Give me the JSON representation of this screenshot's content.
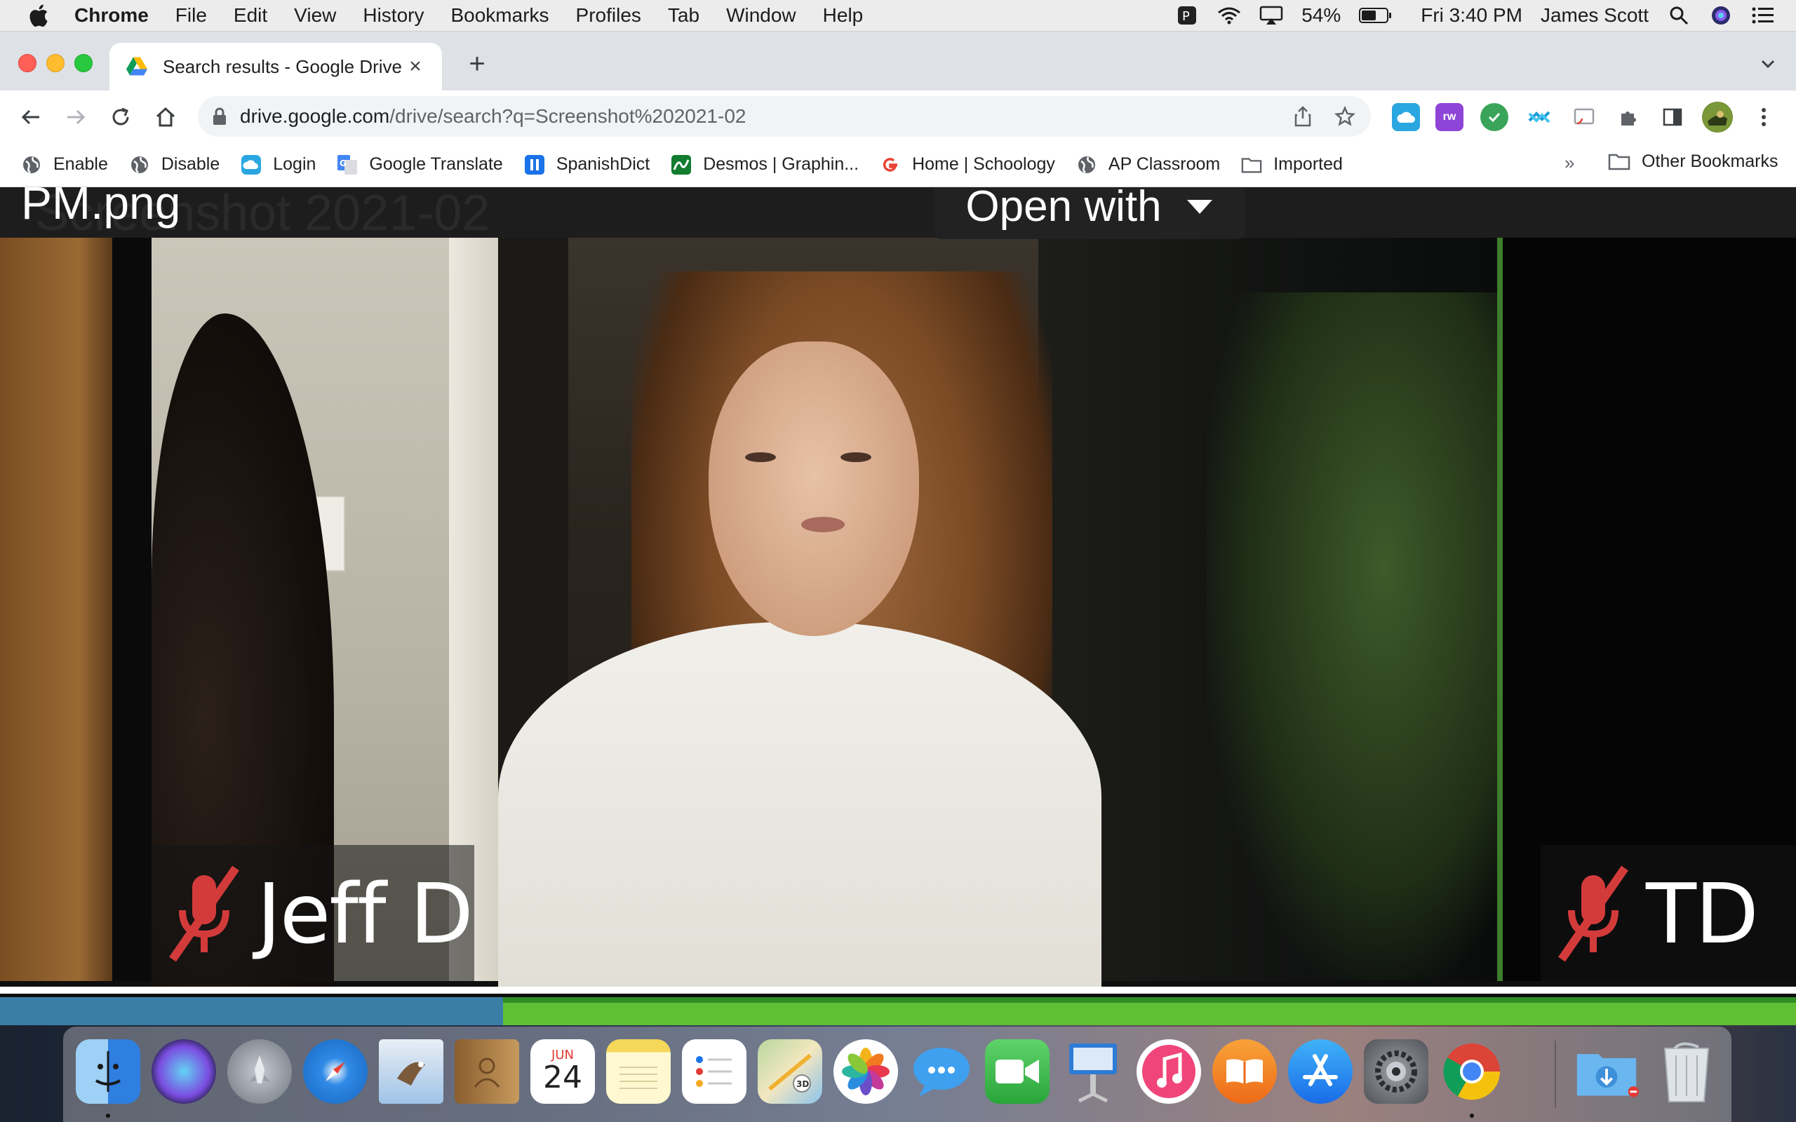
{
  "menubar": {
    "app": "Chrome",
    "items": [
      "File",
      "Edit",
      "View",
      "History",
      "Bookmarks",
      "Profiles",
      "Tab",
      "Window",
      "Help"
    ],
    "battery": "54%",
    "clock": "Fri 3:40 PM",
    "user": "James Scott"
  },
  "tab": {
    "title": "Search results - Google Drive",
    "close": "×",
    "new_tab": "+"
  },
  "omnibox": {
    "host": "drive.google.com",
    "path": "/drive/search?q=Screenshot%202021-02"
  },
  "extensions": [
    {
      "name": "cloud-extension-icon",
      "color": "#2aa7e0",
      "label": ""
    },
    {
      "name": "rw-extension-icon",
      "color": "#8e44d6",
      "label": "rw"
    },
    {
      "name": "grammar-extension-icon",
      "color": "#3aa55a",
      "label": ""
    },
    {
      "name": "sync-extension-icon",
      "color": "#1a9bd7",
      "label": ""
    },
    {
      "name": "cast-extension-icon",
      "color": "#9aa0a6",
      "label": ""
    }
  ],
  "bookmarks": [
    {
      "label": "Enable",
      "icon": "globe-icon"
    },
    {
      "label": "Disable",
      "icon": "globe-icon"
    },
    {
      "label": "Login",
      "icon": "cloud-icon"
    },
    {
      "label": "Google Translate",
      "icon": "translate-icon"
    },
    {
      "label": "SpanishDict",
      "icon": "spanishdict-icon"
    },
    {
      "label": "Desmos | Graphin...",
      "icon": "desmos-icon"
    },
    {
      "label": "Home | Schoology",
      "icon": "google-icon"
    },
    {
      "label": "AP Classroom",
      "icon": "globe-icon"
    },
    {
      "label": "Imported",
      "icon": "folder-icon"
    }
  ],
  "bookmarks_more": "»",
  "bookmarks_other": "Other Bookmarks",
  "viewer": {
    "filename_ghost": "Screenshot 2021-02",
    "filename": "PM.png",
    "open_with": "Open with",
    "participants": [
      "Jeff D",
      "TD"
    ],
    "progress": 0.28
  },
  "dock": [
    {
      "name": "finder-icon",
      "color": "#3d8fe8"
    },
    {
      "name": "siri-icon",
      "color": "#5b3fb0"
    },
    {
      "name": "launchpad-icon",
      "color": "#7b8088"
    },
    {
      "name": "safari-icon",
      "color": "#2f8ae6"
    },
    {
      "name": "mail-icon",
      "color": "#6aa6d8"
    },
    {
      "name": "contacts-icon",
      "color": "#b8864a"
    },
    {
      "name": "calendar-icon",
      "color": "#ffffff"
    },
    {
      "name": "notes-icon",
      "color": "#f7e27a"
    },
    {
      "name": "reminders-icon",
      "color": "#ffffff"
    },
    {
      "name": "maps-icon",
      "color": "#a8d08d"
    },
    {
      "name": "photos-icon",
      "color": "#ffffff"
    },
    {
      "name": "messages-icon",
      "color": "#3fa0f0"
    },
    {
      "name": "facetime-icon",
      "color": "#35b04a"
    },
    {
      "name": "keynote-icon",
      "color": "#2e7bd6"
    },
    {
      "name": "music-icon",
      "color": "#f0457a"
    },
    {
      "name": "books-icon",
      "color": "#f08a24"
    },
    {
      "name": "app-store-icon",
      "color": "#2f8ef0"
    },
    {
      "name": "system-preferences-icon",
      "color": "#6d6f74"
    },
    {
      "name": "chrome-icon",
      "color": "#ffffff"
    },
    {
      "name": "downloads-icon",
      "color": "#6ab6f0"
    },
    {
      "name": "trash-icon",
      "color": "#d8dde3"
    }
  ],
  "calendar": {
    "month": "JUN",
    "day": "24"
  }
}
